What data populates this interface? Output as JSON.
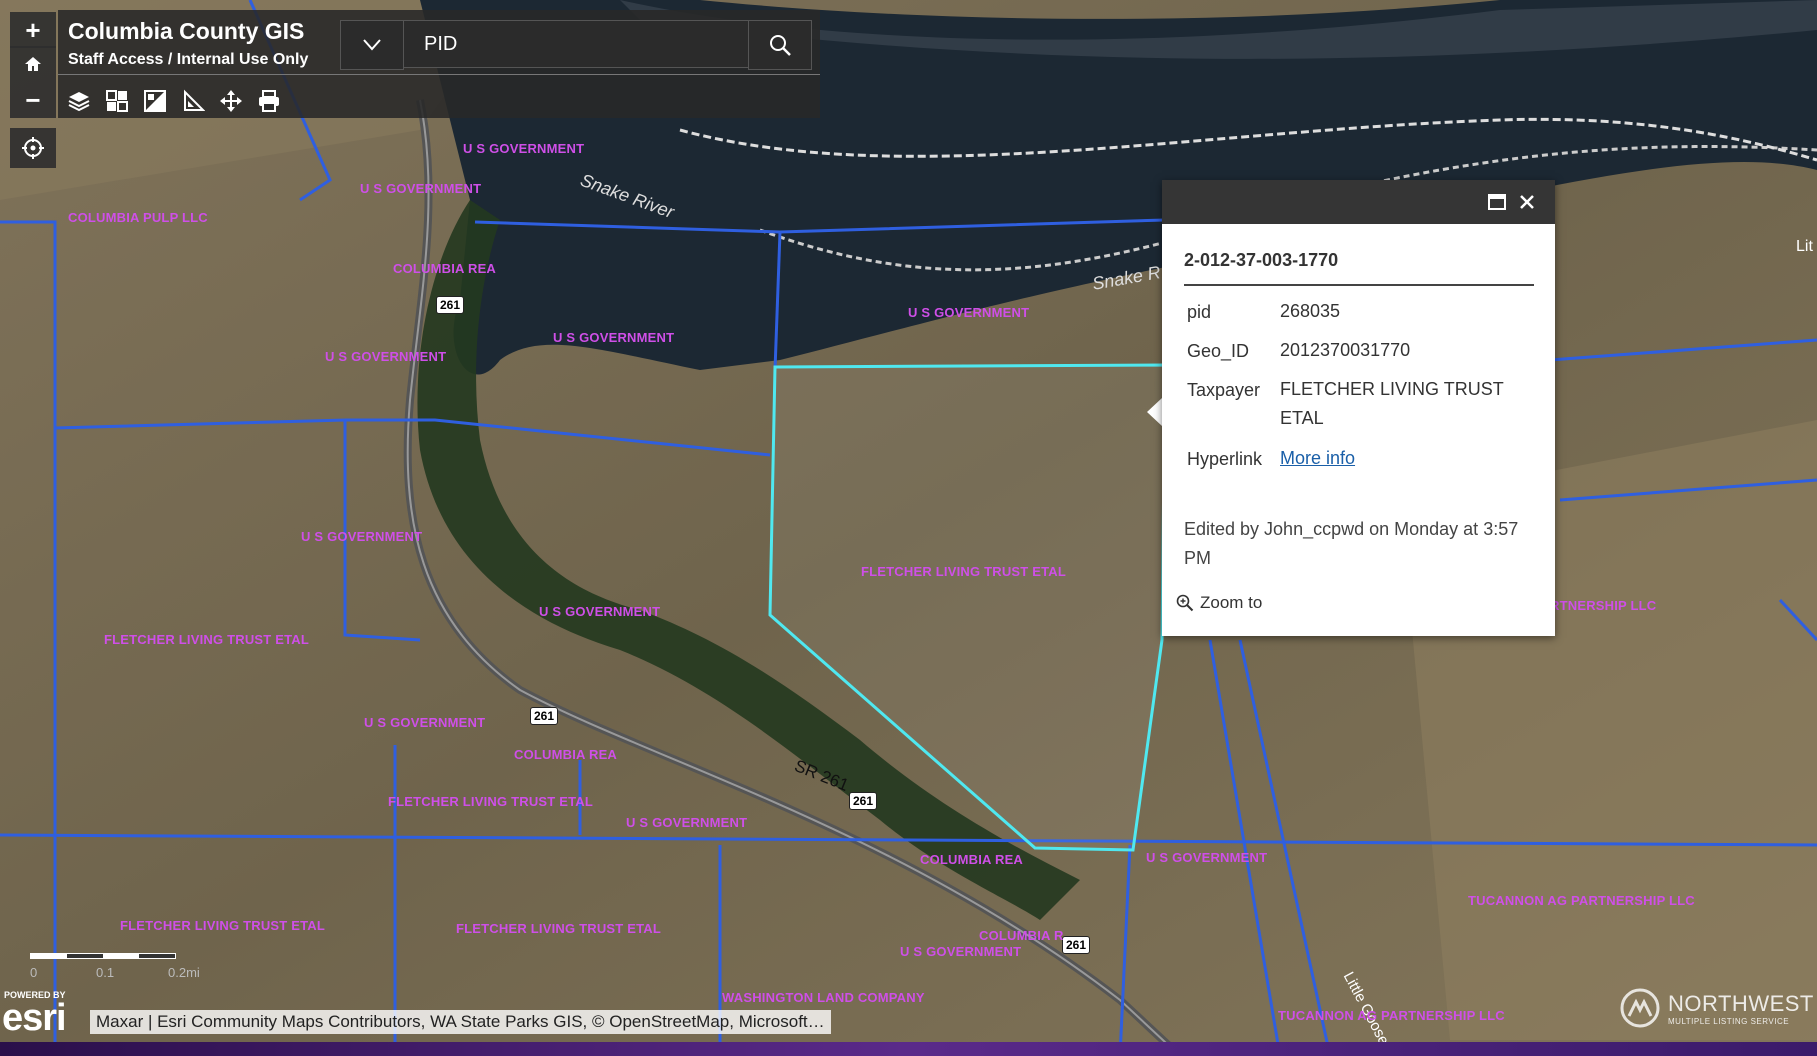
{
  "header": {
    "title": "Columbia County GIS",
    "subtitle": "Staff Access / Internal Use Only"
  },
  "search": {
    "value": "PID"
  },
  "zoom": {
    "in": "+",
    "out": "−"
  },
  "toolbar": {
    "icons": [
      "layers-icon",
      "basemap-gallery-icon",
      "legend-icon",
      "measure-icon",
      "pan-move-icon",
      "print-icon"
    ]
  },
  "map_labels": [
    {
      "text": "U S GOVERNMENT"
    },
    {
      "text": "U S GOVERNMENT"
    },
    {
      "text": "COLUMBIA PULP LLC"
    },
    {
      "text": "COLUMBIA REA"
    },
    {
      "text": "U S GOVERNMENT"
    },
    {
      "text": "U S GOVERNMENT"
    },
    {
      "text": "U S GOVERNMENT"
    },
    {
      "text": "U S GOVERNMENT"
    },
    {
      "text": "FLETCHER LIVING TRUST ETAL"
    },
    {
      "text": "U S GOVERNMENT"
    },
    {
      "text": "FLETCHER LIVING TRUST ETAL"
    },
    {
      "text": "U S GOVERNMENT"
    },
    {
      "text": "COLUMBIA REA"
    },
    {
      "text": "FLETCHER LIVING TRUST ETAL"
    },
    {
      "text": "U S GOVERNMENT"
    },
    {
      "text": "COLUMBIA REA"
    },
    {
      "text": "U S GOVERNMENT"
    },
    {
      "text": "FLETCHER LIVING TRUST ETAL"
    },
    {
      "text": "FLETCHER LIVING TRUST ETAL"
    },
    {
      "text": "COLUMBIA R"
    },
    {
      "text": "U S GOVERNMENT"
    },
    {
      "text": "WASHINGTON LAND COMPANY"
    },
    {
      "text": "TUCANNON AG PARTNERSHIP LLC"
    },
    {
      "text": "RTNERSHIP LLC"
    },
    {
      "text": "TUCANNON AG PARTNERSHIP LLC"
    }
  ],
  "water_labels": {
    "river1": "Snake River",
    "river2": "Snake R",
    "river3": "Lit",
    "road": "SR 261",
    "road2": "Little Goose"
  },
  "route_shields": [
    "261",
    "261",
    "261",
    "261"
  ],
  "popup": {
    "title": "2-012-37-003-1770",
    "fields": [
      {
        "label": "pid",
        "value": "268035"
      },
      {
        "label": "Geo_ID",
        "value": "2012370031770"
      },
      {
        "label": "Taxpayer",
        "value": "FLETCHER LIVING TRUST ETAL"
      },
      {
        "label": "Hyperlink",
        "value": "More info"
      }
    ],
    "edited": "Edited by John_ccpwd on Monday at 3:57 PM",
    "zoom_to": "Zoom to"
  },
  "scale": {
    "labels": [
      "0",
      "0.1",
      "0.2mi"
    ]
  },
  "attribution": "Maxar | Esri Community Maps Contributors, WA State Parks GIS, © OpenStreetMap, Microsoft…",
  "esri": {
    "powered": "POWERED BY",
    "logo": "esri"
  },
  "watermark": {
    "name": "NORTHWEST",
    "sub": "MULTIPLE LISTING SERVICE"
  },
  "colors": {
    "parcel_line": "#2f5fe0",
    "selected_parcel": "#4fe8f0",
    "label": "#cf4fe8",
    "river": "#1c2a35",
    "terrain": "#7a6d52"
  }
}
